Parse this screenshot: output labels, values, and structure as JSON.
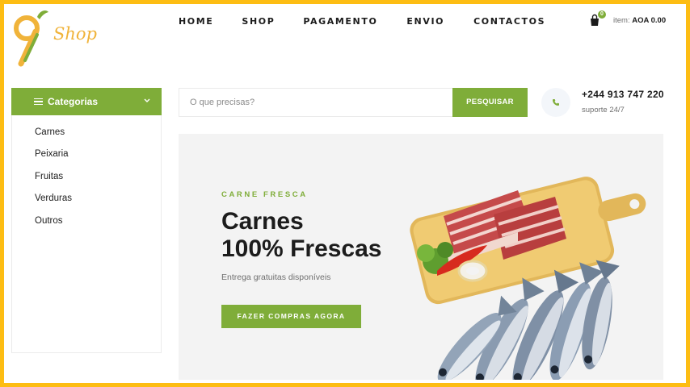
{
  "brand": {
    "logo_text": "Shop"
  },
  "nav": [
    "HOME",
    "SHOP",
    "PAGAMENTO",
    "ENVIO",
    "CONTACTOS"
  ],
  "cart": {
    "count": "0",
    "item_label": "item:",
    "total": "AOA 0.00"
  },
  "categories": {
    "title": "Categorias",
    "items": [
      "Carnes",
      "Peixaria",
      "Fruitas",
      "Verduras",
      "Outros"
    ]
  },
  "search": {
    "placeholder": "O que precisas?",
    "button": "PESQUISAR"
  },
  "contact": {
    "phone": "+244 913 747 220",
    "support": "suporte 24/7"
  },
  "hero": {
    "eyebrow": "CARNE FRESCA",
    "title_line1": "Carnes",
    "title_line2": "100% Frescas",
    "subtitle": "Entrega gratuitas disponíveis",
    "cta": "FAZER COMPRAS AGORA"
  },
  "colors": {
    "accent": "#7fad39",
    "frame": "#fdbd13",
    "logo": "#f0b33a"
  }
}
